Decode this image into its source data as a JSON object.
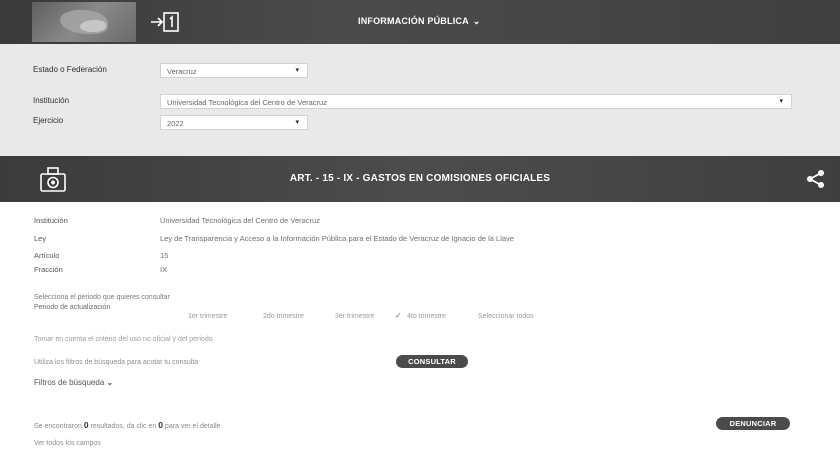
{
  "header": {
    "title": "INFORMACIÓN PÚBLICA",
    "chevron": "⌄",
    "login_icon": "login-door-icon"
  },
  "filters": {
    "estado_label": "Estado o Federación",
    "estado_value": "Veracruz",
    "institucion_label": "Institución",
    "institucion_value": "Universidad Tecnológica del Centro de Veracruz",
    "ejercicio_label": "Ejercicio",
    "ejercicio_value": "2022"
  },
  "article": {
    "title": "ART. - 15 - IX - GASTOS EN COMISIONES OFICIALES",
    "info": [
      {
        "label": "Institución",
        "value": "Universidad Tecnológica del Centro de Veracruz"
      },
      {
        "label": "Ley",
        "value": "Ley de Transparencia y Acceso a la Información Pública para el Estado de Veracruz de Ignacio de la Llave"
      },
      {
        "label": "Artículo",
        "value": "15"
      },
      {
        "label": "Fracción",
        "value": "IX"
      }
    ]
  },
  "period": {
    "prompt": "Selecciona el periodo que quieres consultar",
    "label": "Periodo de actualización",
    "options": [
      "1er trimestre",
      "2do trimestre",
      "3er trimestre",
      "4to trimestre",
      "Seleccionar todos"
    ],
    "checked_index": 3
  },
  "notes": {
    "search_hint": "Tomar en cuenta el criterio del uso no oficial y del periodo",
    "filters_hint": "Utiliza los filtros de búsqueda para acotar tu consulta",
    "consultar_label": "CONSULTAR",
    "filters_toggle": "Filtros de búsqueda",
    "filters_chevron": "⌄"
  },
  "results": {
    "text_before": "Se encontraron",
    "count": "0",
    "text_middle": "resultados, da clic en",
    "count2": "0",
    "text_after": "para ver el detalle",
    "denunciar_label": "DENUNCIAR",
    "ver_todos": "Ver todos los campos"
  }
}
